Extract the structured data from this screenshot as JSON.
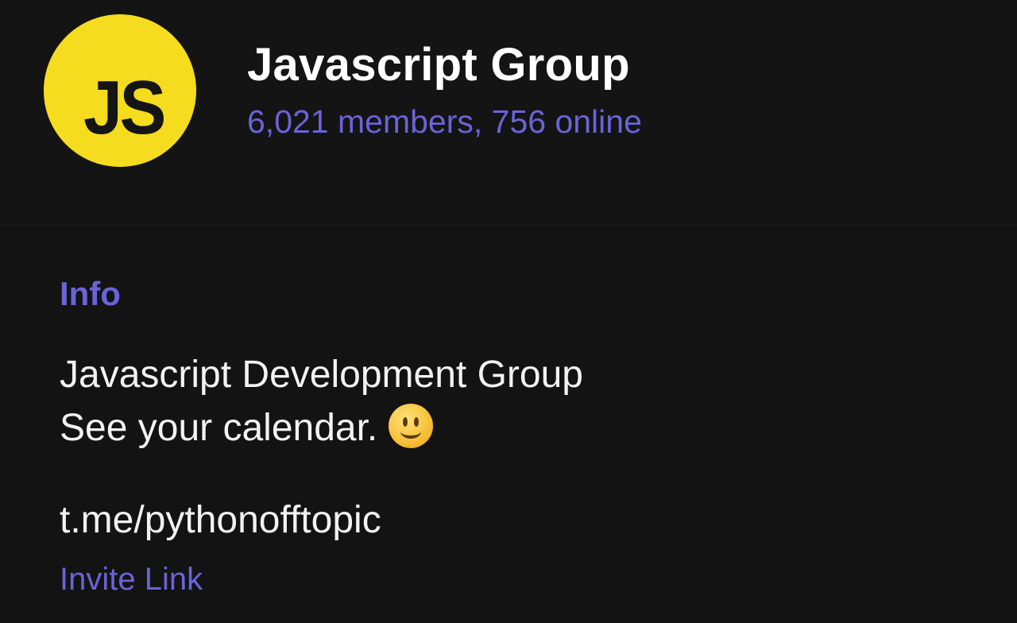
{
  "header": {
    "avatar_text": "JS",
    "title": "Javascript Group",
    "subtitle": "6,021 members, 756 online"
  },
  "info": {
    "heading": "Info",
    "description_line1": "Javascript Development Group",
    "description_line2": "See your calendar.",
    "emoji": "slightly-smiling-face-icon",
    "link": "t.me/pythonofftopic",
    "link_caption": "Invite Link"
  },
  "colors": {
    "background": "#141414",
    "accent": "#6b63d8",
    "avatar_bg": "#f5dc1e",
    "text": "#f2f2f2"
  }
}
